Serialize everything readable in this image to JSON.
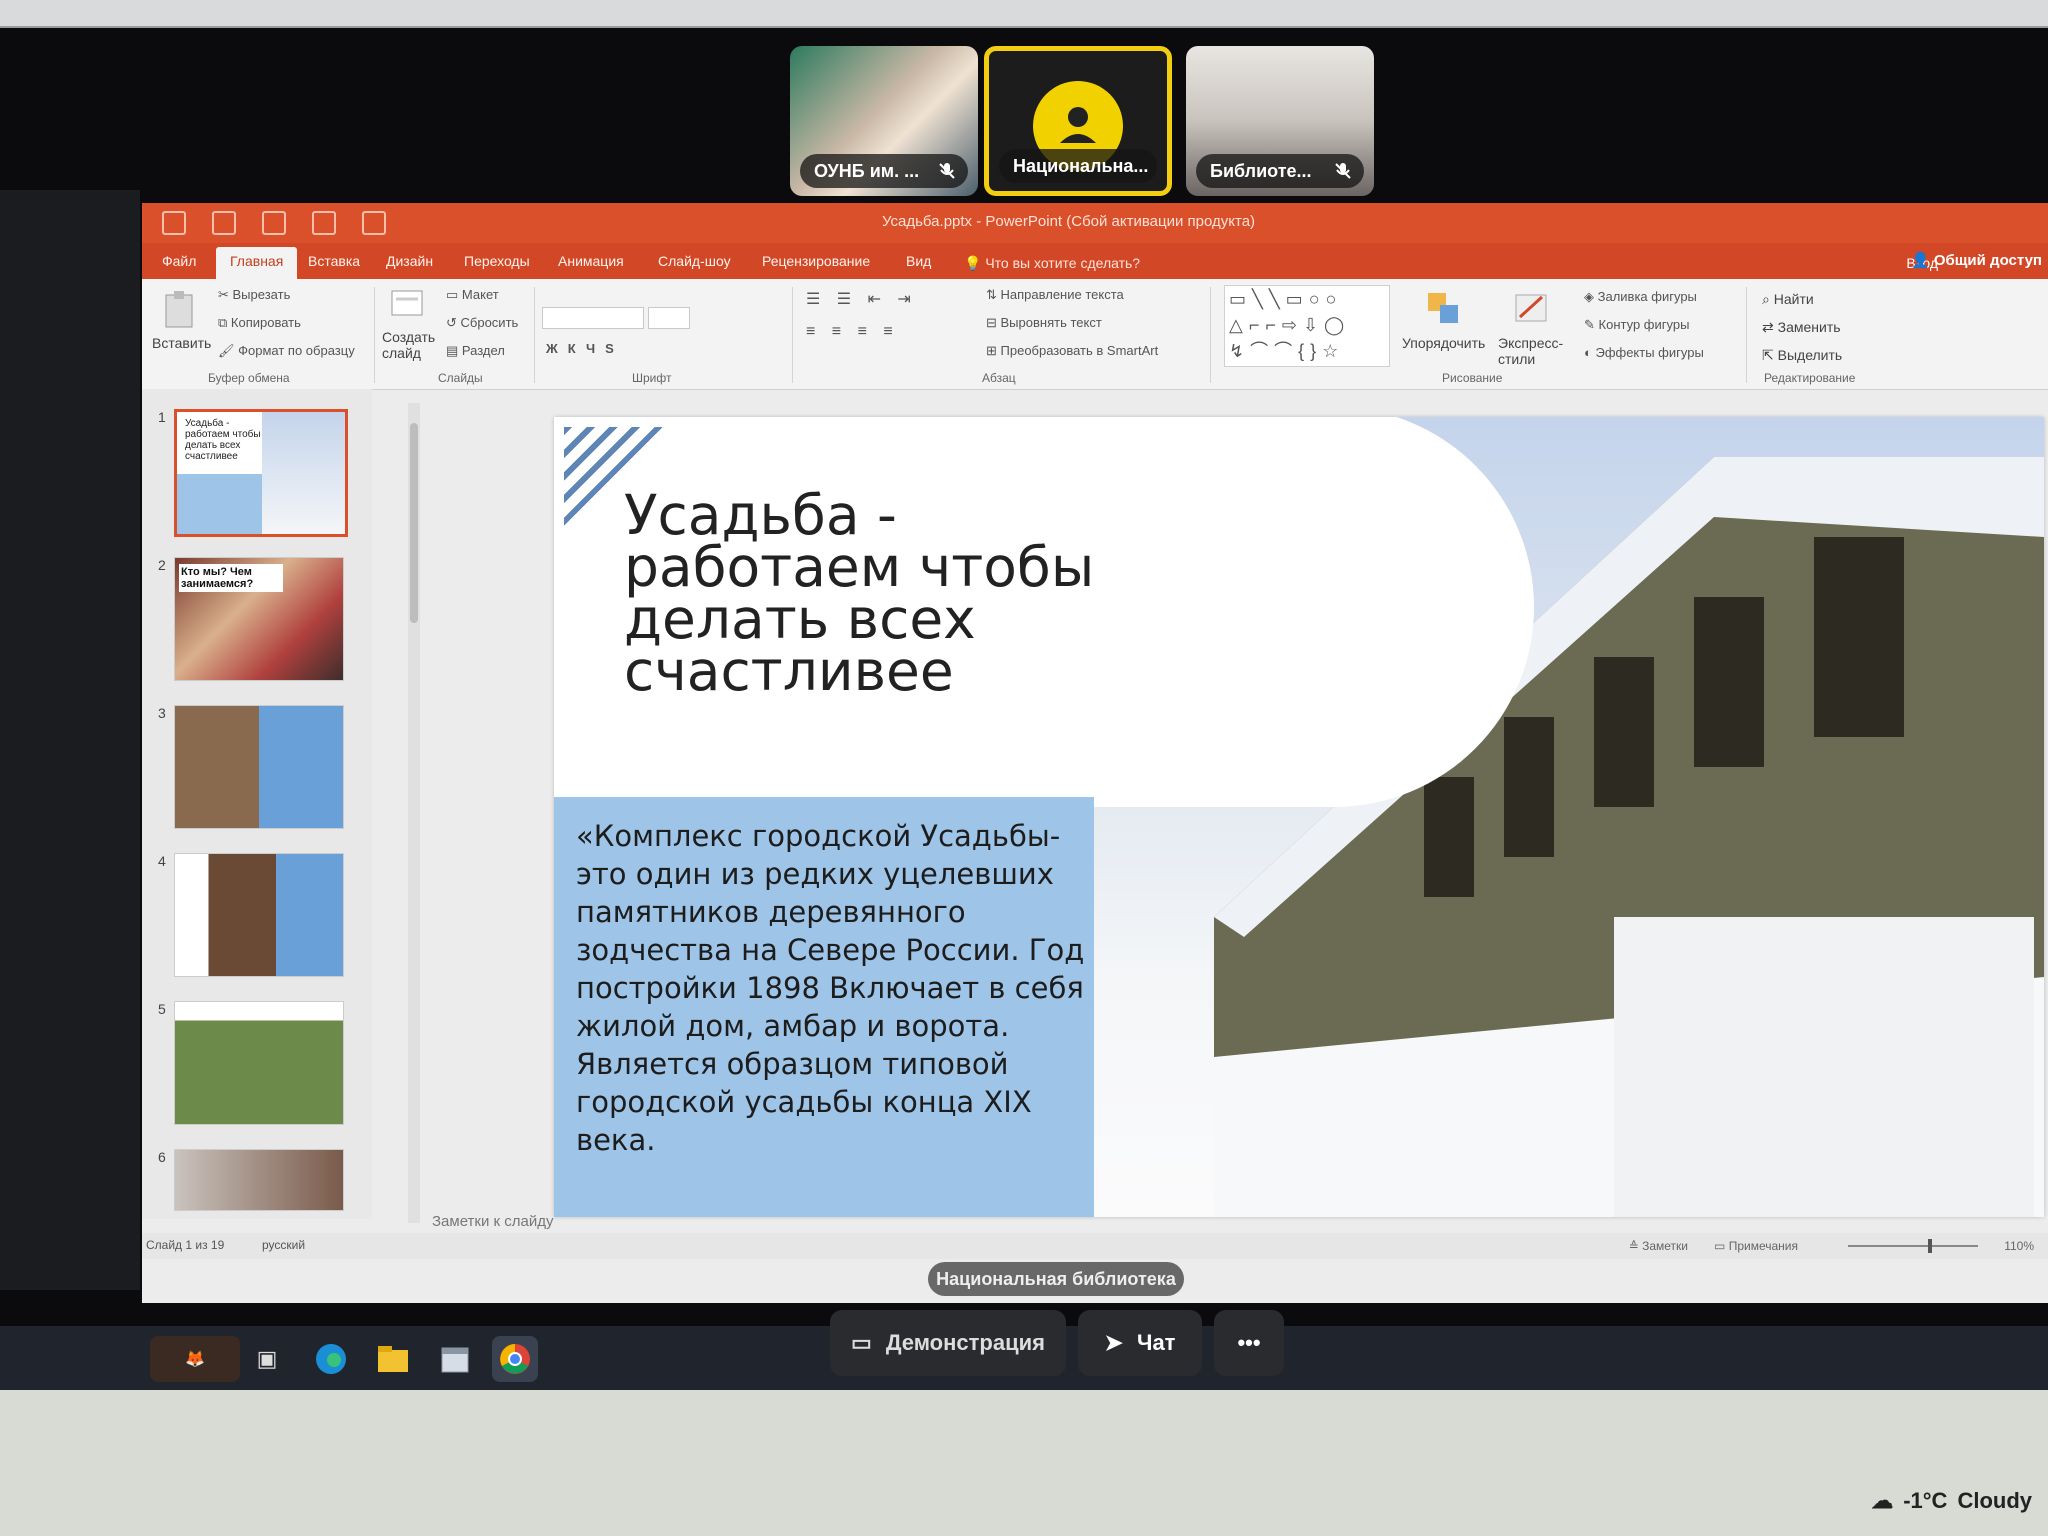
{
  "participants": [
    {
      "name": "ОУНБ им. ...",
      "muted": true
    },
    {
      "name": "Национальна...",
      "muted": false,
      "active": true
    },
    {
      "name": "Библиоте...",
      "muted": true
    }
  ],
  "powerpoint": {
    "window_title": "Усадьба.pptx - PowerPoint (Сбой активации продукта)",
    "tabs": [
      "Файл",
      "Главная",
      "Вставка",
      "Дизайн",
      "Переходы",
      "Анимация",
      "Слайд-шоу",
      "Рецензирование",
      "Вид"
    ],
    "active_tab": "Главная",
    "tell_me": "Что вы хотите сделать?",
    "sign_in": "Вход",
    "share": "Общий доступ",
    "ribbon": {
      "paste": "Вставить",
      "cut": "Вырезать",
      "copy": "Копировать",
      "format_painter": "Формат по образцу",
      "clipboard_group": "Буфер обмена",
      "new_slide": "Создать слайд",
      "layout": "Макет",
      "reset": "Сбросить",
      "section": "Раздел",
      "slides_group": "Слайды",
      "font_group": "Шрифт",
      "text_direction": "Направление текста",
      "align_text": "Выровнять текст",
      "smartart": "Преобразовать в SmartArt",
      "paragraph_group": "Абзац",
      "arrange": "Упорядочить",
      "quick_styles": "Экспресс-стили",
      "shape_fill": "Заливка фигуры",
      "shape_outline": "Контур фигуры",
      "shape_effects": "Эффекты фигуры",
      "drawing_group": "Рисование",
      "find": "Найти",
      "replace": "Заменить",
      "select": "Выделить",
      "editing_group": "Редактирование"
    },
    "thumbnails": [
      {
        "number": "1",
        "caption": "Усадьба - работаем чтобы делать всех счастливее"
      },
      {
        "number": "2",
        "caption": "Кто мы? Чем занимаемся?"
      },
      {
        "number": "3",
        "caption": ""
      },
      {
        "number": "4",
        "caption": ""
      },
      {
        "number": "5",
        "caption": ""
      },
      {
        "number": "6",
        "caption": ""
      }
    ],
    "slide": {
      "title": "Усадьба - работаем чтобы делать всех счастливее",
      "body": "«Комплекс городской Усадьбы- это один из редких уцелевших памятников деревянного зодчества на Севере России. Год постройки 1898 Включает в себя жилой дом, амбар и ворота. Является образцом типовой городской усадьбы конца XIX века."
    },
    "notes_placeholder": "Заметки к слайду",
    "status": {
      "slide_counter": "Слайд 1 из 19",
      "language": "русский",
      "notes": "Заметки",
      "comments": "Примечания",
      "zoom": "110%"
    }
  },
  "speaker_label": "Национальная библиотека",
  "meeting_controls": {
    "demo": "Демонстрация",
    "chat": "Чат",
    "more": "•••"
  },
  "taskbar": {
    "icons": [
      "fox-icon",
      "task-view-icon",
      "edge-icon",
      "explorer-icon",
      "calendar-icon",
      "chrome-icon"
    ]
  },
  "weather": {
    "temp": "-1°C",
    "condition": "Cloudy"
  },
  "colors": {
    "ppt_accent": "#d24726",
    "active_speaker": "#f2cd10",
    "slide_blue": "#9ec4e8"
  }
}
